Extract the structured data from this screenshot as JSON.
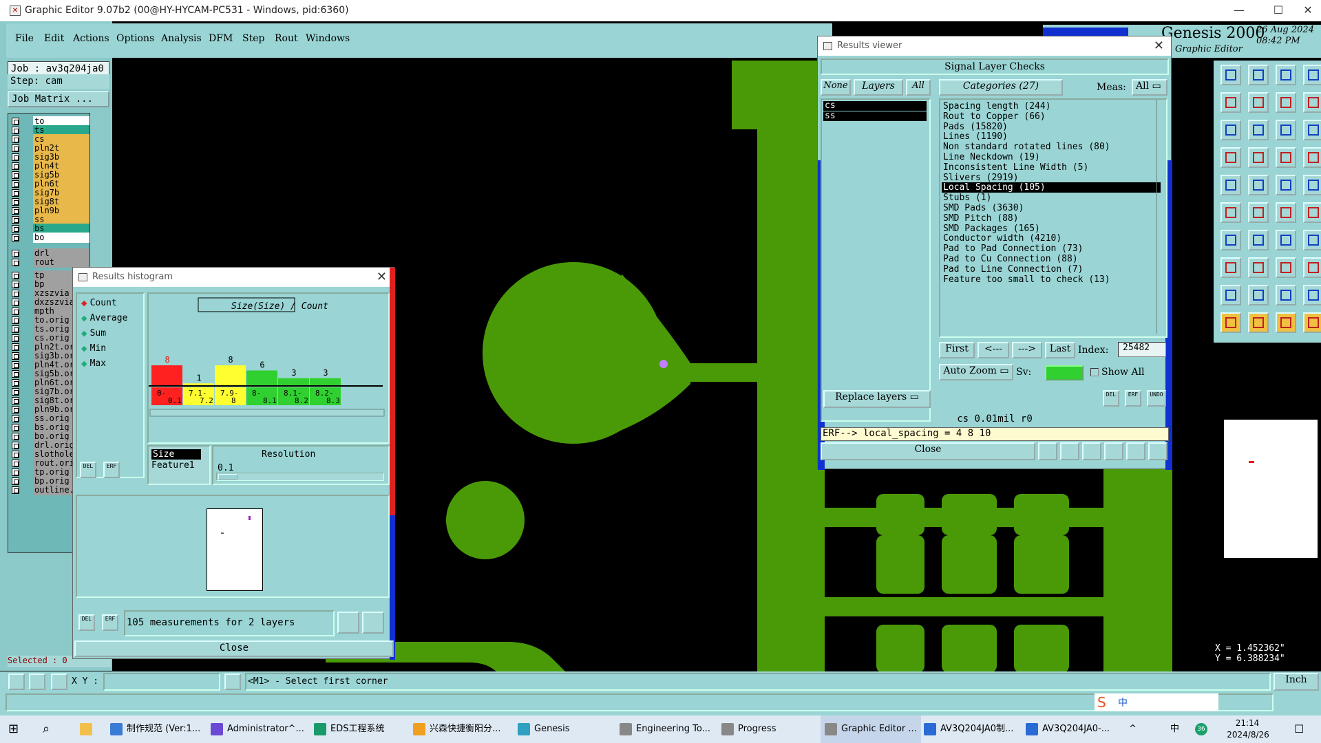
{
  "window": {
    "title": "Graphic Editor 9.07b2 (00@HY-HYCAM-PC531 - Windows, pid:6360)",
    "minimize": "—",
    "maximize": "☐",
    "close": "✕"
  },
  "menu": [
    "File",
    "Edit",
    "Actions",
    "Options",
    "Analysis",
    "DFM",
    "Step",
    "Rout",
    "Windows"
  ],
  "brand": {
    "name": "Genesis 2000",
    "subtitle": "Graphic Editor",
    "date": "26 Aug 2024",
    "time": "08:42 PM"
  },
  "job": {
    "job_label": "Job : av3q204ja0",
    "step_label": "Step: cam",
    "matrix_button": "Job Matrix ..."
  },
  "layers": [
    {
      "name": "to",
      "color": "#ffffff"
    },
    {
      "name": "ts",
      "color": "#2aa88c"
    },
    {
      "name": "cs",
      "color": "#e8b84a"
    },
    {
      "name": "pln2t",
      "color": "#e8b84a"
    },
    {
      "name": "sig3b",
      "color": "#e8b84a"
    },
    {
      "name": "pln4t",
      "color": "#e8b84a"
    },
    {
      "name": "sig5b",
      "color": "#e8b84a"
    },
    {
      "name": "pln6t",
      "color": "#e8b84a"
    },
    {
      "name": "sig7b",
      "color": "#e8b84a"
    },
    {
      "name": "sig8t",
      "color": "#e8b84a"
    },
    {
      "name": "pln9b",
      "color": "#e8b84a"
    },
    {
      "name": "ss",
      "color": "#e8b84a"
    },
    {
      "name": "bs",
      "color": "#2aa88c"
    },
    {
      "name": "bo",
      "color": "#ffffff"
    },
    {
      "name": "drl",
      "color": "#a0a0a0"
    },
    {
      "name": "rout",
      "color": "#a0a0a0"
    },
    {
      "name": "tp",
      "color": "#a0a0a0"
    },
    {
      "name": "bp",
      "color": "#a0a0a0"
    },
    {
      "name": "xzszvia",
      "color": "#a0a0a0"
    },
    {
      "name": "dxzszvia",
      "color": "#a0a0a0"
    },
    {
      "name": "mpth",
      "color": "#a0a0a0"
    },
    {
      "name": "to.orig",
      "color": "#a0a0a0"
    },
    {
      "name": "ts.orig",
      "color": "#a0a0a0"
    },
    {
      "name": "cs.orig",
      "color": "#a0a0a0"
    },
    {
      "name": "pln2t.or",
      "color": "#a0a0a0"
    },
    {
      "name": "sig3b.or",
      "color": "#a0a0a0"
    },
    {
      "name": "pln4t.or",
      "color": "#a0a0a0"
    },
    {
      "name": "sig5b.or",
      "color": "#a0a0a0"
    },
    {
      "name": "pln6t.or",
      "color": "#a0a0a0"
    },
    {
      "name": "sig7b.or",
      "color": "#a0a0a0"
    },
    {
      "name": "sig8t.or",
      "color": "#a0a0a0"
    },
    {
      "name": "pln9b.or",
      "color": "#a0a0a0"
    },
    {
      "name": "ss.orig",
      "color": "#a0a0a0"
    },
    {
      "name": "bs.orig",
      "color": "#a0a0a0"
    },
    {
      "name": "bo.orig",
      "color": "#a0a0a0"
    },
    {
      "name": "drl.orig",
      "color": "#a0a0a0"
    },
    {
      "name": "slothole",
      "color": "#a0a0a0"
    },
    {
      "name": "rout.ori",
      "color": "#a0a0a0"
    },
    {
      "name": "tp.orig",
      "color": "#a0a0a0"
    },
    {
      "name": "bp.orig",
      "color": "#a0a0a0"
    },
    {
      "name": "outline.",
      "color": "#a0a0a0"
    }
  ],
  "selected_label": "Selected : 0",
  "histogram": {
    "title": "Results histogram",
    "modes": [
      "Count",
      "Average",
      "Sum",
      "Min",
      "Max"
    ],
    "chart_title": "Size(Size) / Count",
    "bars": [
      {
        "count": "8",
        "range": "0-0.1",
        "range_l1": "0-",
        "range_l2": "0.1",
        "color": "#ff2020"
      },
      {
        "count": "1",
        "range": "7.1-7.2",
        "range_l1": "7.1-",
        "range_l2": "7.2",
        "color": "#ffff30"
      },
      {
        "count": "8",
        "range": "7.9-8",
        "range_l1": "7.9-",
        "range_l2": "8",
        "color": "#ffff30"
      },
      {
        "count": "6",
        "range": "8-8.1",
        "range_l1": "8-",
        "range_l2": "8.1",
        "color": "#30d030"
      },
      {
        "count": "3",
        "range": "8.1-8.2",
        "range_l1": "8.1-",
        "range_l2": "8.2",
        "color": "#30d030"
      },
      {
        "count": "3",
        "range": "8.2-8.3",
        "range_l1": "8.2-",
        "range_l2": "8.3",
        "color": "#30d030"
      }
    ],
    "field_size": "Size",
    "field_feature": "Feature1",
    "resolution_label": "Resolution",
    "resolution_value": "0.1",
    "summary": "105 measurements for 2 layers",
    "close": "Close",
    "del": "DEL",
    "erf": "ERF"
  },
  "results": {
    "title": "Results viewer",
    "header": "Signal Layer Checks",
    "none": "None",
    "layers_btn": "Layers",
    "all": "All",
    "categories_btn": "Categories (27)",
    "meas_label": "Meas:",
    "meas_value": "All",
    "layer_items": [
      "cs",
      "ss"
    ],
    "categories": [
      "Spacing length (244)",
      "Rout to Copper (66)",
      "Pads (15820)",
      "Lines (1190)",
      "Non standard rotated lines (80)",
      "Line Neckdown (19)",
      "Inconsistent Line Width (5)",
      "Slivers (2919)",
      "Local Spacing (105)",
      "Stubs (1)",
      "SMD Pads (3630)",
      "SMD Pitch (88)",
      "SMD Packages (165)",
      "Conductor width (4210)",
      "Pad to Pad Connection (73)",
      "Pad to Cu Connection (88)",
      "Pad to Line Connection (7)",
      "Feature too small to check (13)"
    ],
    "selected_category_index": 8,
    "first": "First",
    "prev": "<---",
    "next": "--->",
    "last": "Last",
    "index_label": "Index:",
    "index_value": "25482",
    "auto_zoom": "Auto Zoom",
    "sv_label": "Sv:",
    "show_all": "Show All",
    "replace_layers": "Replace layers",
    "info_line": "cs 0.01mil  r0",
    "erf_line": "ERF--> local_spacing = 4 8 10",
    "close": "Close",
    "del": "DEL",
    "erf": "ERF",
    "undo": "UNDO"
  },
  "coords": {
    "x": "X =  1.452362\"",
    "y": "Y =  6.388234\""
  },
  "command": {
    "xy_label": "X Y :",
    "xy_value": "",
    "prompt": "<M1> - Select first corner",
    "units": "Inch"
  },
  "colors": {
    "copper": "#4a9a08",
    "panel": "#9ad4d4",
    "marker": "#c080ff",
    "highlight_blue": "#1030d0",
    "highlight_red": "#e02020"
  },
  "taskbar": {
    "items": [
      "制作规范 (Ver:1...",
      "Administrator^...",
      "EDS工程系统",
      "兴森快捷衡阳分...",
      "Genesis",
      "Engineering To...",
      "Progress",
      "Graphic Editor ...",
      "AV3Q204JA0制...",
      "AV3Q204JA0-..."
    ],
    "clock_time": "21:14",
    "clock_date": "2024/8/26",
    "ime": "中",
    "badge": "36"
  }
}
